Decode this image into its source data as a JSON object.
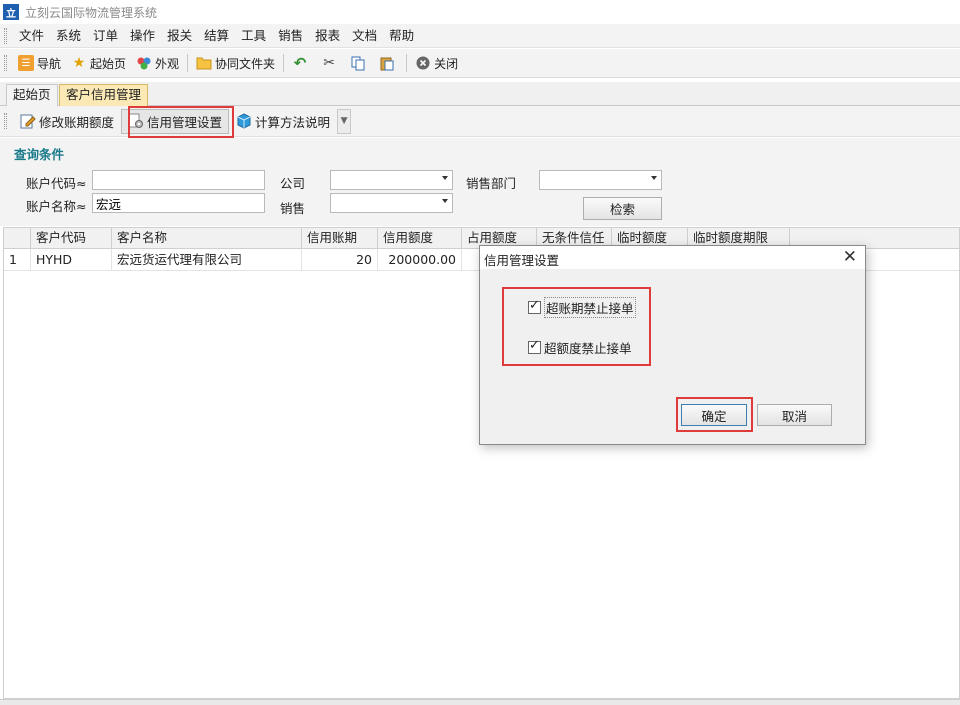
{
  "window": {
    "title": "立刻云国际物流管理系统"
  },
  "menu": [
    "文件",
    "系统",
    "订单",
    "操作",
    "报关",
    "结算",
    "工具",
    "销售",
    "报表",
    "文档",
    "帮助"
  ],
  "toolbar": {
    "nav": "导航",
    "home": "起始页",
    "appearance": "外观",
    "shared_folder": "协同文件夹",
    "close": "关闭"
  },
  "tabs": [
    "起始页",
    "客户信用管理"
  ],
  "actions": {
    "edit_term": "修改账期额度",
    "credit_settings": "信用管理设置",
    "calc_desc": "计算方法说明"
  },
  "query": {
    "title": "查询条件",
    "account_code_label": "账户代码≈",
    "account_code_value": "",
    "account_name_label": "账户名称≈",
    "account_name_value": "宏远",
    "company_label": "公司",
    "sales_label": "销售",
    "dept_label": "销售部门",
    "search_btn": "检索"
  },
  "grid": {
    "columns": [
      "客户代码",
      "客户名称",
      "信用账期",
      "信用额度",
      "占用额度",
      "无条件信任",
      "临时额度",
      "临时额度期限"
    ],
    "rows": [
      {
        "index": "1",
        "code": "HYHD",
        "name": "宏远货运代理有限公司",
        "term": "20",
        "limit": "200000.00"
      }
    ]
  },
  "dialog": {
    "title": "信用管理设置",
    "opt_overdue": "超账期禁止接单",
    "opt_overdue_checked": true,
    "opt_overlimit": "超额度禁止接单",
    "opt_overlimit_checked": true,
    "ok": "确定",
    "cancel": "取消"
  },
  "colors": {
    "highlight": "#e03b3b",
    "active_tab": "#fbe9b5",
    "section_title": "#1a7a8a"
  }
}
